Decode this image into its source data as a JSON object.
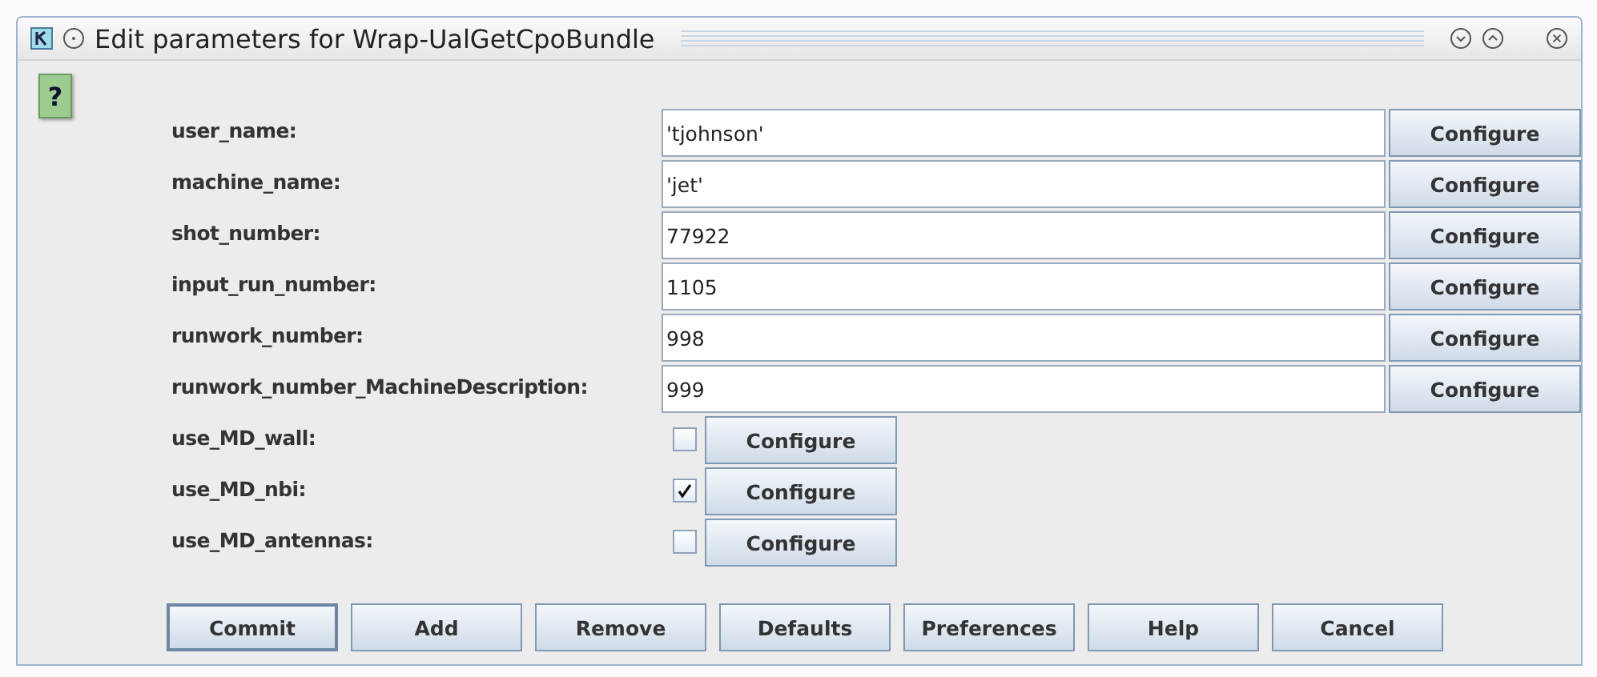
{
  "window": {
    "title": "Edit parameters for Wrap-UalGetCpoBundle"
  },
  "help_icon": {
    "text": "?"
  },
  "parameters": [
    {
      "kind": "text",
      "label": "user_name:",
      "value": "'tjohnson'",
      "button": "Configure"
    },
    {
      "kind": "text",
      "label": "machine_name:",
      "value": "'jet'",
      "button": "Configure"
    },
    {
      "kind": "text",
      "label": "shot_number:",
      "value": "77922",
      "button": "Configure"
    },
    {
      "kind": "text",
      "label": "input_run_number:",
      "value": "1105",
      "button": "Configure"
    },
    {
      "kind": "text",
      "label": "runwork_number:",
      "value": "998",
      "button": "Configure"
    },
    {
      "kind": "text",
      "label": "runwork_number_MachineDescription:",
      "value": "999",
      "button": "Configure"
    },
    {
      "kind": "checkbox",
      "label": "use_MD_wall:",
      "checked": false,
      "button": "Configure"
    },
    {
      "kind": "checkbox",
      "label": "use_MD_nbi:",
      "checked": true,
      "button": "Configure"
    },
    {
      "kind": "checkbox",
      "label": "use_MD_antennas:",
      "checked": false,
      "button": "Configure"
    }
  ],
  "buttons": [
    {
      "label": "Commit",
      "default": true
    },
    {
      "label": "Add",
      "default": false
    },
    {
      "label": "Remove",
      "default": false
    },
    {
      "label": "Defaults",
      "default": false
    },
    {
      "label": "Preferences",
      "default": false
    },
    {
      "label": "Help",
      "default": false
    },
    {
      "label": "Cancel",
      "default": false
    }
  ]
}
